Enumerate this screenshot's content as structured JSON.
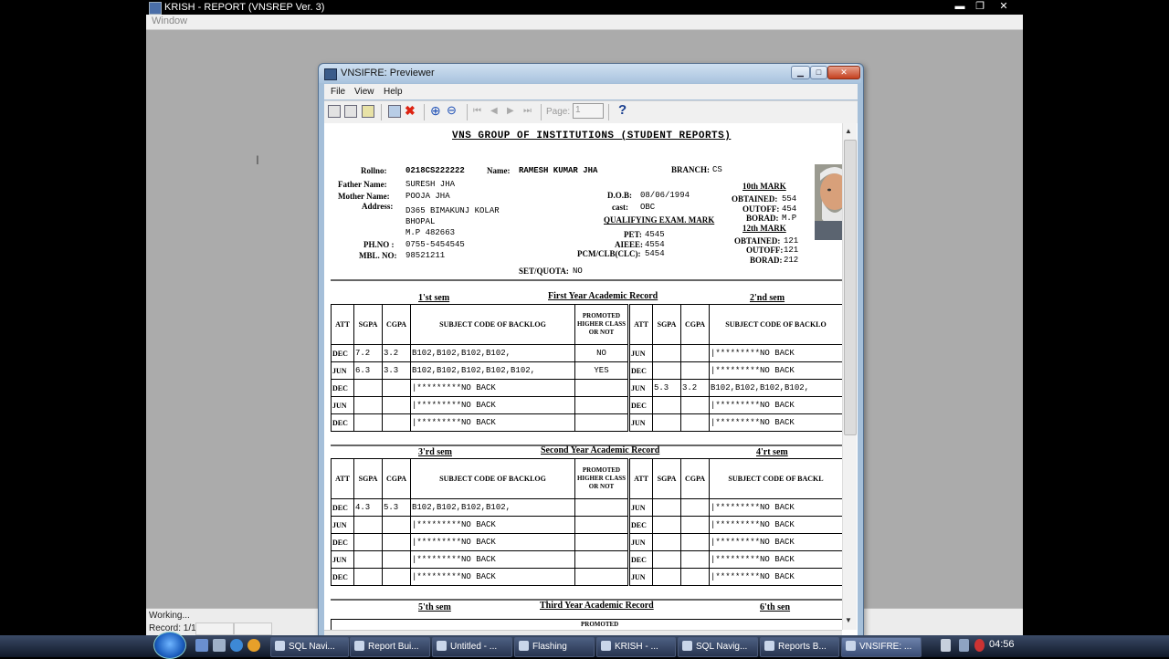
{
  "app": {
    "title": "KRISH  - REPORT (VNSREP Ver. 3)",
    "menu": "Window",
    "status_line1": "Working...",
    "status_line2": "Record: 1/1",
    "cursor_glyph": "I"
  },
  "previewer": {
    "title": "VNSIFRE: Previewer",
    "menu": [
      "File",
      "View",
      "Help"
    ],
    "page_label": "Page:",
    "page_value": "1",
    "help_glyph": "?"
  },
  "report": {
    "heading": "VNS GROUP OF INSTITUTIONS (STUDENT REPORTS)",
    "rollno_label": "Rollno:",
    "rollno": "0218CS222222",
    "name_label": "Name:",
    "name": "RAMESH KUMAR JHA",
    "branch_label": "BRANCH:",
    "branch": "CS",
    "father_label": "Father Name:",
    "father": "SURESH JHA",
    "mother_label": "Mother Name:",
    "mother": "POOJA JHA",
    "address_label": "Address:",
    "address_1": "D365 BIMAKUNJ KOLAR",
    "address_2": "BHOPAL",
    "address_3": "M.P  482663",
    "phno_label": "PH.NO :",
    "phno": "0755-5454545",
    "mbl_label": "MBL. NO:",
    "mbl": "98521211",
    "dob_label": "D.O.B:",
    "dob": "08/06/1994",
    "cast_label": "cast:",
    "cast": "OBC",
    "qual_label": "QUALIFYING EXAM. MARK",
    "pet_label": "PET:",
    "pet": "4545",
    "aieee_label": "AIEEE:",
    "aieee": "4554",
    "pcm_label": "PCM/CLB(CLC):",
    "pcm": "5454",
    "quota_label": "SET/QUOTA:",
    "quota": "NO",
    "tenth_label": "10th MARK",
    "tenth_obtained_label": "OBTAINED:",
    "tenth_obtained": "554",
    "tenth_outoff_label": "OUTOFF:",
    "tenth_outoff": "454",
    "tenth_board_label": "BORAD:",
    "tenth_board": "M.P",
    "twelfth_label": "12th MARK",
    "twelfth_obtained_label": "OBTAINED:",
    "twelfth_obtained": "121",
    "twelfth_outoff_label": "OUTOFF:",
    "twelfth_outoff": "121",
    "twelfth_board_label": "BORAD:",
    "twelfth_board": "212"
  },
  "columns": {
    "att": "ATT",
    "sgpa": "SGPA",
    "cgpa": "CGPA",
    "backlog": "SUBJECT CODE OF BACKLOG",
    "backlog_cut1": "SUBJECT CODE OF BACKLO",
    "backlog_cut2": "SUBJECT CODE OF BACKL",
    "promoted": "PROMOTED HIGHER CLASS OR NOT"
  },
  "years": [
    {
      "title": "First Year Academic Record",
      "left_sem": "1'st sem",
      "right_sem": "2'nd sem",
      "left_rows": [
        [
          "DEC",
          "7.2",
          "3.2",
          "B102,B102,B102,B102,",
          "NO"
        ],
        [
          "JUN",
          "6.3",
          "3.3",
          "B102,B102,B102,B102,B102,",
          "YES"
        ],
        [
          "DEC",
          "",
          "",
          "|*********NO BACK",
          ""
        ],
        [
          "JUN",
          "",
          "",
          "|*********NO BACK",
          ""
        ],
        [
          "DEC",
          "",
          "",
          "|*********NO BACK",
          ""
        ]
      ],
      "right_rows": [
        [
          "JUN",
          "",
          "",
          "|*********NO BACK"
        ],
        [
          "DEC",
          "",
          "",
          "|*********NO BACK"
        ],
        [
          "JUN",
          "5.3",
          "3.2",
          "B102,B102,B102,B102,"
        ],
        [
          "DEC",
          "",
          "",
          "|*********NO BACK"
        ],
        [
          "JUN",
          "",
          "",
          "|*********NO BACK"
        ]
      ]
    },
    {
      "title": "Second Year Academic Record",
      "left_sem": "3'rd sem",
      "right_sem": "4'rt sem",
      "left_rows": [
        [
          "DEC",
          "4.3",
          "5.3",
          "B102,B102,B102,B102,",
          ""
        ],
        [
          "JUN",
          "",
          "",
          "|*********NO BACK",
          ""
        ],
        [
          "DEC",
          "",
          "",
          "|*********NO BACK",
          ""
        ],
        [
          "JUN",
          "",
          "",
          "|*********NO BACK",
          ""
        ],
        [
          "DEC",
          "",
          "",
          "|*********NO BACK",
          ""
        ]
      ],
      "right_rows": [
        [
          "JUN",
          "",
          "",
          "|*********NO BACK"
        ],
        [
          "DEC",
          "",
          "",
          "|*********NO BACK"
        ],
        [
          "JUN",
          "",
          "",
          "|*********NO BACK"
        ],
        [
          "DEC",
          "",
          "",
          "|*********NO BACK"
        ],
        [
          "JUN",
          "",
          "",
          "|*********NO BACK"
        ]
      ]
    },
    {
      "title": "Third Year Academic Record",
      "left_sem": "5'th sem",
      "right_sem": "6'th sen"
    }
  ],
  "third_year_partial_header": "PROMOTED",
  "taskbar": {
    "items": [
      "SQL Navi...",
      "Report Bui...",
      "Untitled - ...",
      "Flashing",
      "KRISH  - ...",
      "SQL Navig...",
      "Reports B...",
      "VNSIFRE: ..."
    ],
    "active_index": 7,
    "clock": "04:56"
  }
}
